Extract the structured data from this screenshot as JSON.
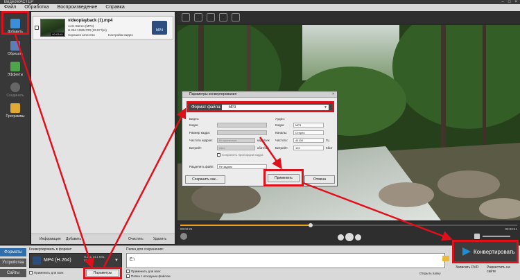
{
  "window": {
    "title": "ВидеоМАСТЕР"
  },
  "menu": {
    "items": [
      "Файл",
      "Обработка",
      "Воспроизведение",
      "Справка"
    ]
  },
  "left_toolbar": {
    "items": [
      {
        "label": "Добавить",
        "icon": "add-icon"
      },
      {
        "label": "Обрезать",
        "icon": "cut-icon"
      },
      {
        "label": "Эффекты",
        "icon": "effects-icon"
      },
      {
        "label": "Соединить",
        "icon": "join-icon"
      },
      {
        "label": "Программы",
        "icon": "programs-icon"
      }
    ]
  },
  "file": {
    "name": "videoplayback (1).mp4",
    "duration": "00:03:41",
    "line1": "AAC Stereo (MP4)",
    "line2": "H.264 1280x720 (29.97 fps)",
    "line3": "Хорошее качество",
    "line4": "Настройки видео",
    "format_badge": "MP4"
  },
  "list_bar": {
    "info": "Информация",
    "add": "Добавить",
    "clear": "Очистить",
    "delete": "Удалить"
  },
  "player": {
    "time_current": "00:02:21",
    "time_total": "00:03:41"
  },
  "bottom": {
    "tabs": [
      "Форматы",
      "Устройства",
      "Сайты"
    ],
    "convert_label": "Конвертировать в формат:",
    "format_name": "MP4 (H.264)",
    "format_info": "H.264, 44.1 KHz, 256Kbit",
    "apply_all": "Применить для всех",
    "params_button": "Параметры",
    "path_label": "Папка для сохранения:",
    "path_value": "E:\\",
    "apply_all2": "Применить для всех",
    "source_folder": "Папка с исходным файлом",
    "open_folder": "Открыть папку",
    "burn_dvd": "Записать DVD",
    "web": "Разместить на сайте"
  },
  "convert_button": {
    "label": "Конвертировать"
  },
  "dialog": {
    "title": "Параметры конвертирования",
    "format_label": "Формат файла:",
    "format_value": "MP3",
    "video_section": "Видео:",
    "audio_section": "Аудио:",
    "video_rows": [
      {
        "label": "Кодек:",
        "value": ""
      },
      {
        "label": "Размер кадра:",
        "value": ""
      },
      {
        "label": "Частота кадров:",
        "value": "Из оригинала",
        "unit": "кадр/сек"
      },
      {
        "label": "Битрейт:",
        "value": "Авто",
        "unit": "кбит/сек"
      }
    ],
    "aspect_check": "Сохранить пропорции кадра",
    "audio_rows": [
      {
        "label": "Кодек:",
        "value": "MP3"
      },
      {
        "label": "Каналы:",
        "value": "Стерео"
      },
      {
        "label": "Частота:",
        "value": "44100",
        "unit": "Гц"
      },
      {
        "label": "Битрейт:",
        "value": "192",
        "unit": "Кбит"
      }
    ],
    "split_label": "Разделить файл:",
    "split_value": "Не задано",
    "save_as": "Сохранить как...",
    "apply": "Применить",
    "cancel": "Отмена"
  }
}
